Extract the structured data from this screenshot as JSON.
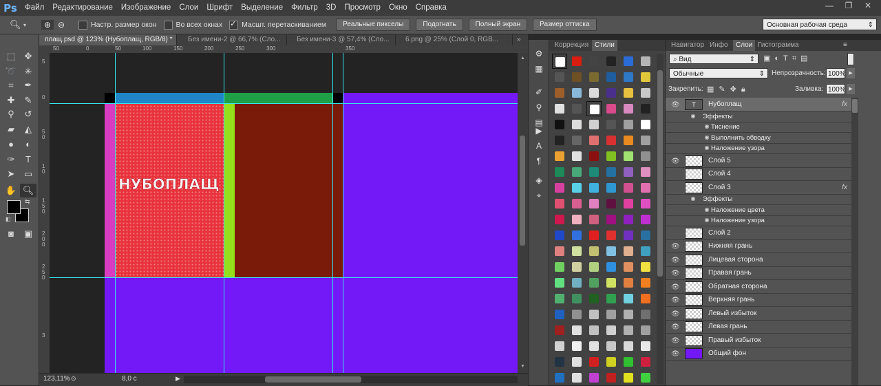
{
  "app": {
    "logo": "Ps"
  },
  "menu": [
    "Файл",
    "Редактирование",
    "Изображение",
    "Слои",
    "Шрифт",
    "Выделение",
    "Фильтр",
    "3D",
    "Просмотр",
    "Окно",
    "Справка"
  ],
  "window_controls": {
    "minimize": "—",
    "maximize": "❐",
    "close": "✕"
  },
  "options": {
    "resize_windows": "Настр. размер окон",
    "all_windows": "Во всех окнах",
    "scrubby_zoom": "Масшт. перетаскиванием",
    "scrubby_checked": true,
    "buttons": [
      "Реальные пикселы",
      "Подогнать",
      "Полный экран",
      "Размер оттиска"
    ],
    "workspace": "Основная рабочая среда"
  },
  "doc_tabs": [
    "плащ.psd @ 123% (Нубоплащ, RGB/8) *",
    "Без имени-2 @ 66,7% (Сло...",
    "Без имени-3 @ 57,4% (Сло...",
    "6.png @ 25% (Слой 0, RGB..."
  ],
  "ruler": {
    "h_labels": [
      "50",
      "0",
      "50",
      "100",
      "150",
      "200",
      "250",
      "300",
      "350"
    ],
    "v_labels": [
      "5",
      "0",
      "5",
      "0",
      "1",
      "0",
      "1",
      "5",
      "0",
      "2",
      "0",
      "0",
      "2",
      "5",
      "0",
      "3"
    ]
  },
  "canvas": {
    "layer_text": "НУБОПЛАЩ",
    "colors": {
      "purple": "#7318f7",
      "red": "#e8323c",
      "maroon": "#7a1a08",
      "magenta": "#d83cc0",
      "lime": "#95e01a",
      "blue": "#1f86c8",
      "green": "#1fa046",
      "black": "#000000",
      "dark": "#232323"
    }
  },
  "status": {
    "zoom": "123,11%",
    "doc": "8,0 с"
  },
  "panels": {
    "styles_tabs": [
      "Коррекция",
      "Стили"
    ],
    "layers_tabs": [
      "Навигатор",
      "Инфо",
      "Слои",
      "Гистограмма"
    ],
    "kind_filter": "Вид",
    "blend_mode": "Обычные",
    "opacity_label": "Непрозрачность:",
    "opacity": "100%",
    "lock_label": "Закрепить:",
    "fill_label": "Заливка:",
    "fill": "100%"
  },
  "layers": [
    {
      "name": "Нубоплащ",
      "type": "text",
      "fx": true,
      "selected": true
    },
    {
      "name": "Эффекты",
      "sub": true
    },
    {
      "name": "Тиснение",
      "sub": true,
      "deep": true
    },
    {
      "name": "Выполнить обводку",
      "sub": true,
      "deep": true
    },
    {
      "name": "Наложение узора",
      "sub": true,
      "deep": true
    },
    {
      "name": "Слой 5"
    },
    {
      "name": "Слой 4",
      "hidden": true
    },
    {
      "name": "Слой 3",
      "fx": true,
      "hidden": true
    },
    {
      "name": "Эффекты",
      "sub": true
    },
    {
      "name": "Наложение цвета",
      "sub": true,
      "deep": true
    },
    {
      "name": "Наложение узора",
      "sub": true,
      "deep": true
    },
    {
      "name": "Слой 2",
      "hidden": true
    },
    {
      "name": "Нижняя грань"
    },
    {
      "name": "Лицевая сторона"
    },
    {
      "name": "Правая грань"
    },
    {
      "name": "Обратная сторона"
    },
    {
      "name": "Верхняя грань"
    },
    {
      "name": "Левый избыток"
    },
    {
      "name": "Левая грань"
    },
    {
      "name": "Правый избыток"
    },
    {
      "name": "Общий фон",
      "fill": "#7318f7"
    }
  ],
  "fx_label": "fx"
}
